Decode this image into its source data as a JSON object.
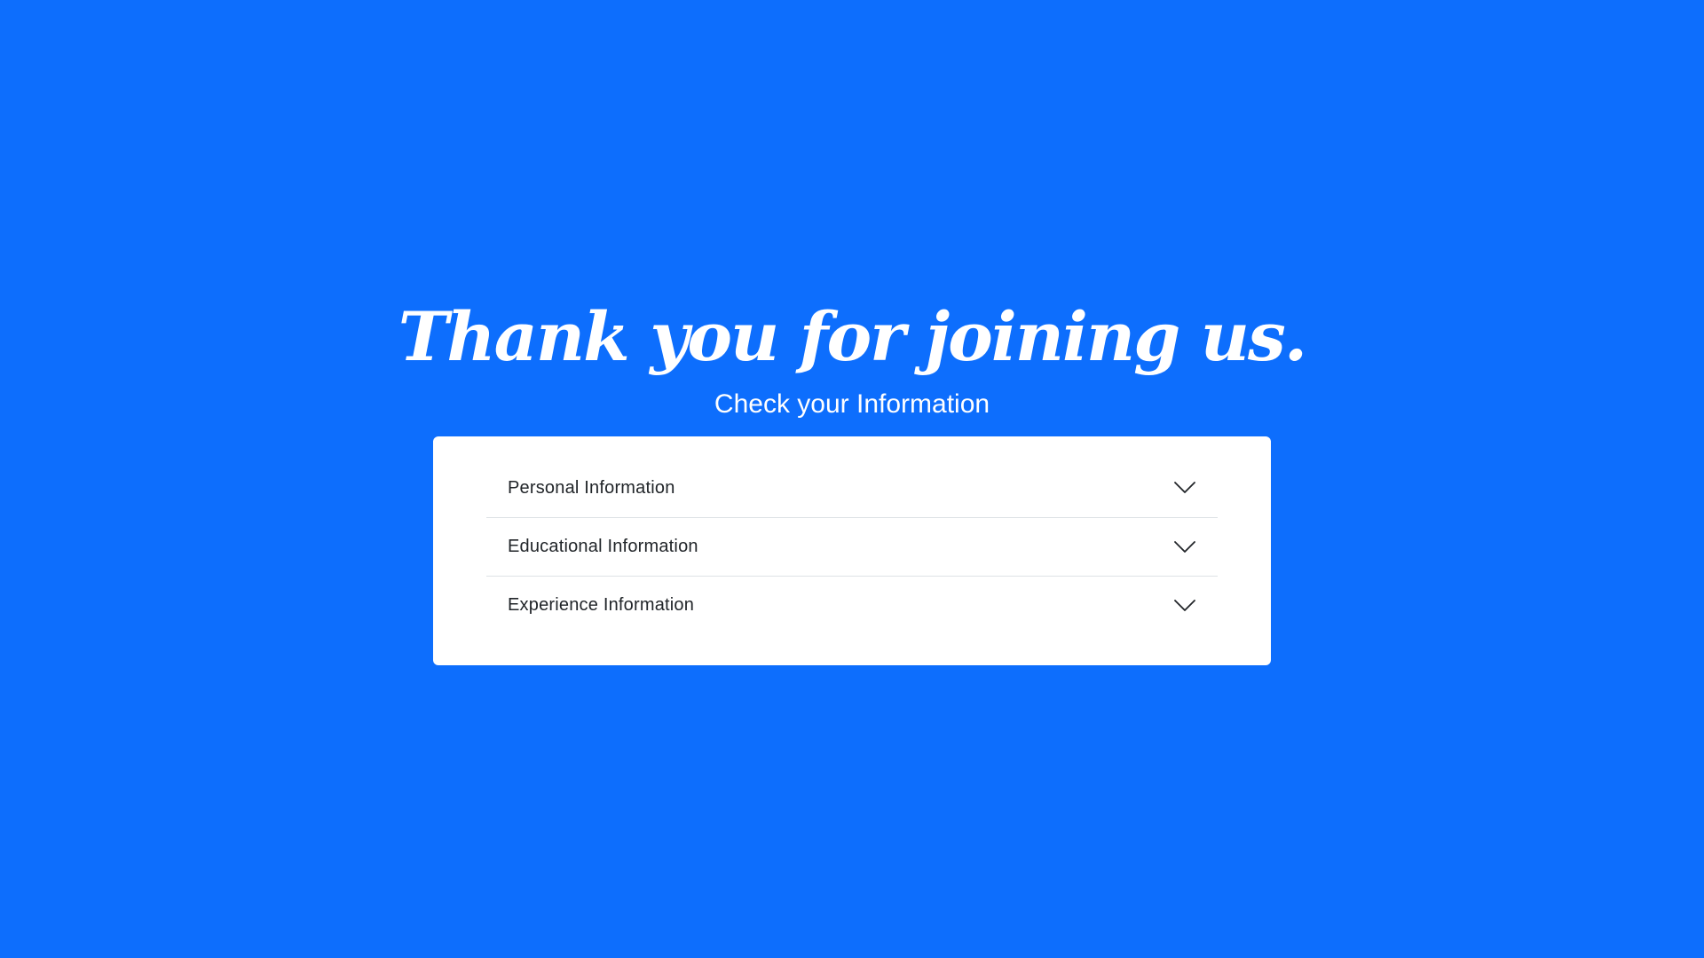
{
  "page": {
    "background_color": "#0d6efd",
    "title": "Thank you for joining us.",
    "subtitle": "Check your Information"
  },
  "accordion": {
    "items": [
      {
        "label": "Personal Information",
        "icon": "chevron-down-icon",
        "expanded": false
      },
      {
        "label": "Educational Information",
        "icon": "chevron-down-icon",
        "expanded": false
      },
      {
        "label": "Experience Information",
        "icon": "chevron-down-icon",
        "expanded": false
      }
    ]
  }
}
